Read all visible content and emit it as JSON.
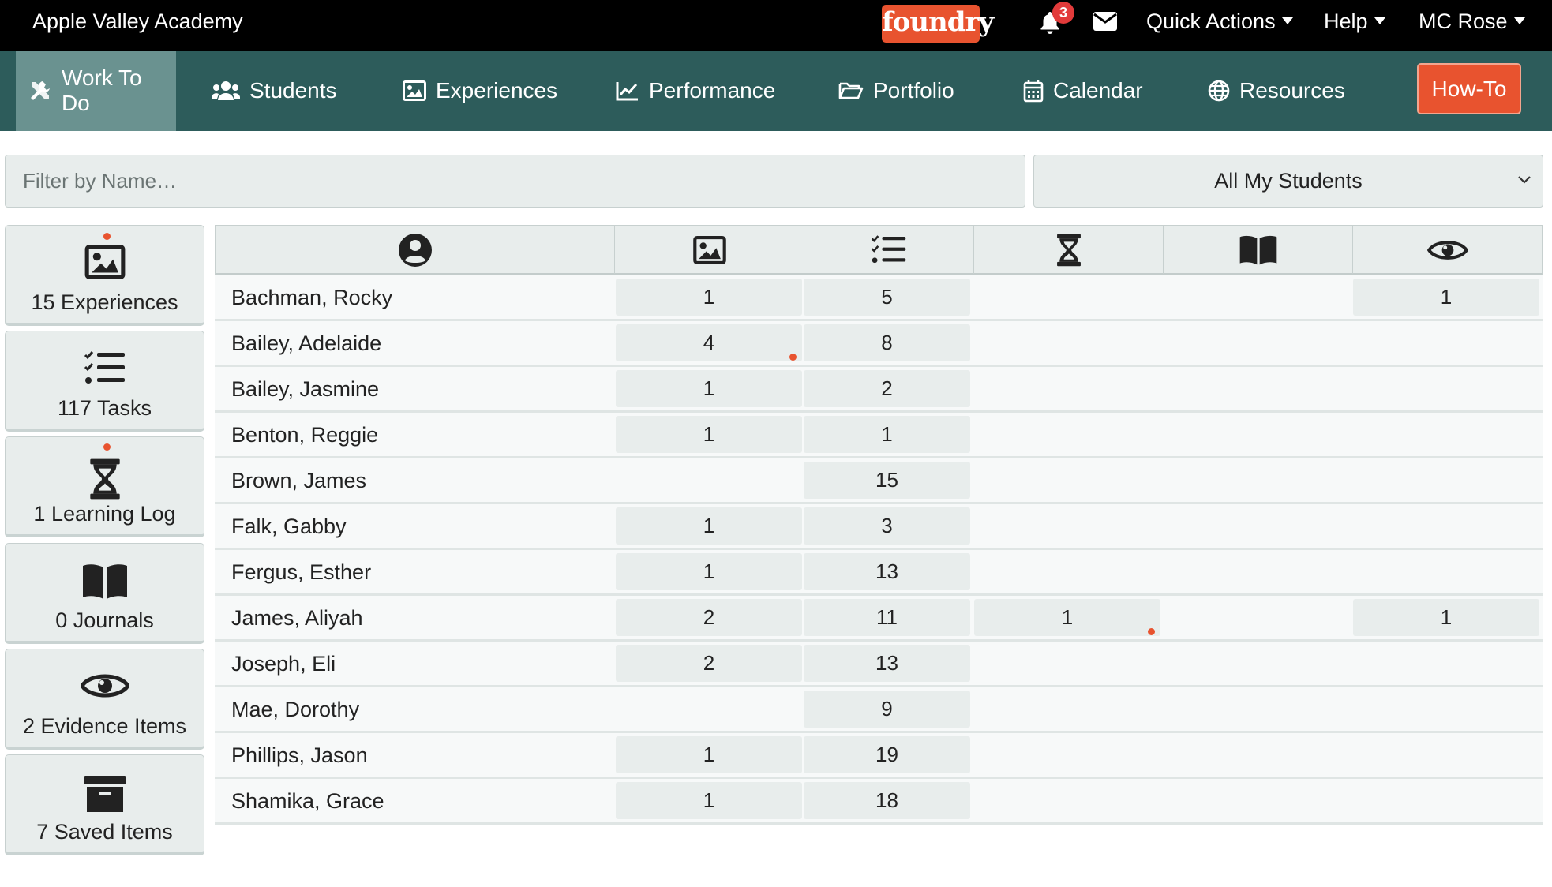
{
  "top_bar": {
    "school_name": "Apple Valley Academy",
    "logo_text": "foundry",
    "notifications_count": "3",
    "quick_actions_label": "Quick Actions",
    "help_label": "Help",
    "user_label": "MC Rose"
  },
  "nav": {
    "items": [
      {
        "label": "Work To Do",
        "icon": "tools-icon",
        "active": true
      },
      {
        "label": "Students",
        "icon": "users-icon"
      },
      {
        "label": "Experiences",
        "icon": "image-icon"
      },
      {
        "label": "Performance",
        "icon": "chart-icon"
      },
      {
        "label": "Portfolio",
        "icon": "folder-icon"
      },
      {
        "label": "Calendar",
        "icon": "calendar-icon"
      },
      {
        "label": "Resources",
        "icon": "globe-icon"
      }
    ],
    "howto_label": "How-To"
  },
  "filter": {
    "placeholder": "Filter by Name…",
    "select_value": "All My Students"
  },
  "sidebar": {
    "cards": [
      {
        "label": "15 Experiences",
        "icon": "image-icon",
        "has_dot": true
      },
      {
        "label": "117 Tasks",
        "icon": "tasks-icon",
        "has_dot": false
      },
      {
        "label": "1 Learning Log",
        "icon": "hourglass-icon",
        "has_dot": true
      },
      {
        "label": "0 Journals",
        "icon": "book-icon",
        "has_dot": false
      },
      {
        "label": "2 Evidence Items",
        "icon": "eye-icon",
        "has_dot": false
      },
      {
        "label": "7 Saved Items",
        "icon": "archive-icon",
        "has_dot": false
      }
    ]
  },
  "table": {
    "columns": [
      "student-icon",
      "experiences-icon",
      "tasks-icon",
      "learning-log-icon",
      "journals-icon",
      "evidence-icon"
    ],
    "rows": [
      {
        "name": "Bachman, Rocky",
        "experiences": "1",
        "tasks": "5",
        "logs": "",
        "journals": "",
        "evidence": "1"
      },
      {
        "name": "Bailey, Adelaide",
        "experiences": "4",
        "tasks": "8",
        "logs": "",
        "journals": "",
        "evidence": ""
      },
      {
        "name": "Bailey, Jasmine",
        "experiences": "1",
        "tasks": "2",
        "logs": "",
        "journals": "",
        "evidence": ""
      },
      {
        "name": "Benton, Reggie",
        "experiences": "1",
        "tasks": "1",
        "logs": "",
        "journals": "",
        "evidence": ""
      },
      {
        "name": "Brown, James",
        "experiences": "",
        "tasks": "15",
        "logs": "",
        "journals": "",
        "evidence": ""
      },
      {
        "name": "Falk, Gabby",
        "experiences": "1",
        "tasks": "3",
        "logs": "",
        "journals": "",
        "evidence": ""
      },
      {
        "name": "Fergus, Esther",
        "experiences": "1",
        "tasks": "13",
        "logs": "",
        "journals": "",
        "evidence": ""
      },
      {
        "name": "James, Aliyah",
        "experiences": "2",
        "tasks": "11",
        "logs": "1",
        "journals": "",
        "evidence": "1"
      },
      {
        "name": "Joseph, Eli",
        "experiences": "2",
        "tasks": "13",
        "logs": "",
        "journals": "",
        "evidence": ""
      },
      {
        "name": "Mae, Dorothy",
        "experiences": "",
        "tasks": "9",
        "logs": "",
        "journals": "",
        "evidence": ""
      },
      {
        "name": "Phillips, Jason",
        "experiences": "1",
        "tasks": "19",
        "logs": "",
        "journals": "",
        "evidence": ""
      },
      {
        "name": "Shamika, Grace",
        "experiences": "1",
        "tasks": "18",
        "logs": "",
        "journals": "",
        "evidence": ""
      }
    ]
  },
  "colors": {
    "nav_bg": "#2d5c5b",
    "nav_active": "#6a9290",
    "accent": "#e8532f",
    "cell_bg": "#e8edec"
  }
}
